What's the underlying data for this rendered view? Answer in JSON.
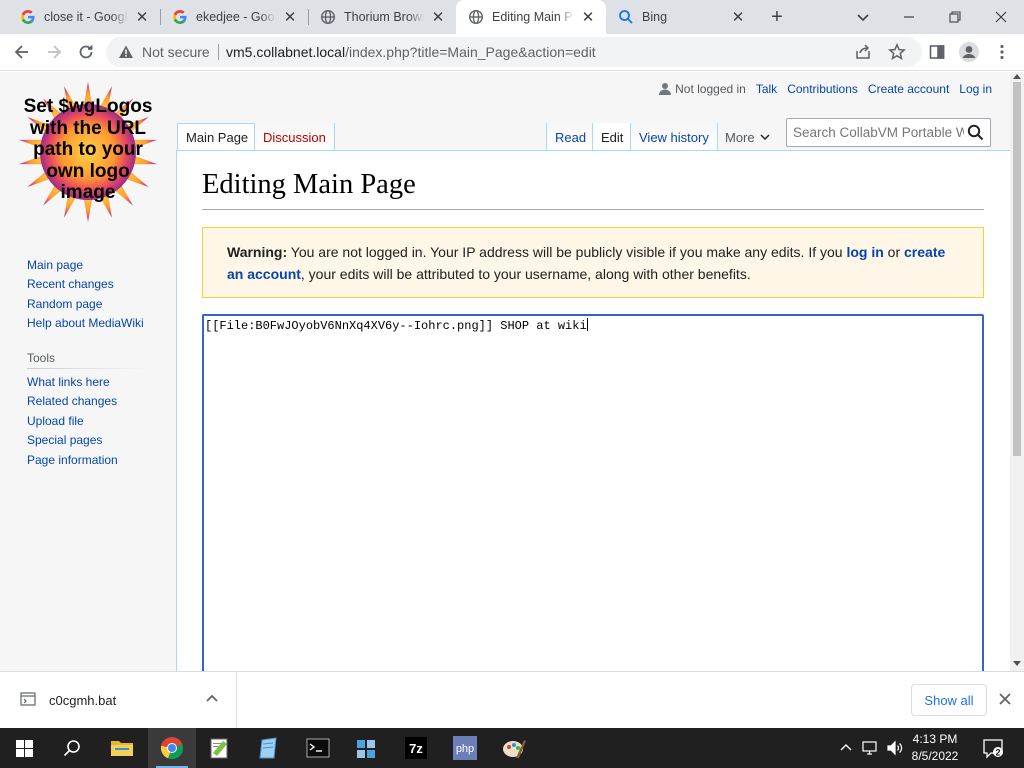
{
  "browser": {
    "tabs": [
      {
        "title": "close it - Google Search",
        "favicon": "google-g-icon",
        "active": false
      },
      {
        "title": "ekedjee - Google Search",
        "favicon": "google-g-icon",
        "active": false
      },
      {
        "title": "Thorium Browser",
        "favicon": "globe-icon",
        "active": false
      },
      {
        "title": "Editing Main Page - CollabVM Portable Wiki",
        "favicon": "globe-icon",
        "active": true
      },
      {
        "title": "Bing",
        "favicon": "search-icon",
        "active": false
      }
    ],
    "new_tab_label": "+",
    "omnibox": {
      "security_label": "Not secure",
      "url_host": "vm5.collabnet.local",
      "url_path": "/index.php?title=Main_Page&action=edit"
    }
  },
  "wiki": {
    "logo_text": "Set $wgLogos with the URL path to your own logo image",
    "personal": {
      "not_logged_in": "Not logged in",
      "talk": "Talk",
      "contributions": "Contributions",
      "create_account": "Create account",
      "log_in": "Log in"
    },
    "namespaces": {
      "main": "Main Page",
      "discussion": "Discussion"
    },
    "views": {
      "read": "Read",
      "edit": "Edit",
      "history": "View history",
      "more": "More"
    },
    "search_placeholder": "Search CollabVM Portable Wiki",
    "navigation": [
      "Main page",
      "Recent changes",
      "Random page",
      "Help about MediaWiki"
    ],
    "tools_heading": "Tools",
    "tools": [
      "What links here",
      "Related changes",
      "Upload file",
      "Special pages",
      "Page information"
    ],
    "heading": "Editing Main Page",
    "warning": {
      "bold": "Warning:",
      "text1": " You are not logged in. Your IP address will be publicly visible if you make any edits. If you ",
      "login_link": "log in",
      "text2": " or ",
      "create_link": "create an account",
      "text3": ", your edits will be attributed to your username, along with other benefits."
    },
    "editor_content": "[[File:B0FwJOyobV6NnXq4XV6y--Iohrc.png]] SHOP at wiki"
  },
  "downloads": {
    "filename": "c0cgmh.bat",
    "show_all": "Show all"
  },
  "taskbar": {
    "time": "4:13 PM",
    "date": "8/5/2022",
    "apps": [
      "start-icon",
      "search-icon",
      "file-explorer-icon",
      "chrome-icon",
      "notepad-plus-plus-icon",
      "notepad-icon",
      "terminal-icon",
      "registry-editor-icon",
      "7zip-icon",
      "php-icon",
      "paint-icon"
    ]
  },
  "colors": {
    "link": "#0645ad",
    "visited_new": "#ba0000",
    "warning_bg": "#fef6e7",
    "warning_border": "#ffcc33",
    "editor_border": "#3366cc",
    "chrome_tab_strip": "#dee1e6",
    "taskbar": "#202020"
  }
}
